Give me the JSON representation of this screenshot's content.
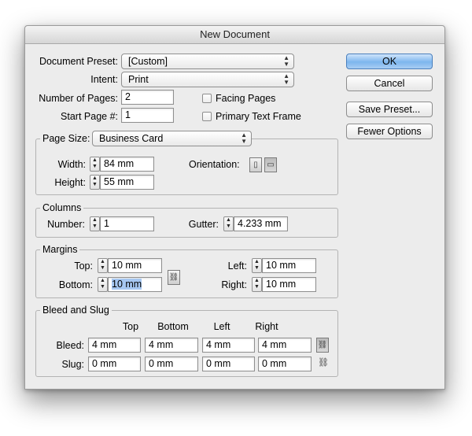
{
  "window": {
    "title": "New Document"
  },
  "document": {
    "preset_label": "Document Preset:",
    "preset_value": "[Custom]",
    "intent_label": "Intent:",
    "intent_value": "Print",
    "pages_label": "Number of Pages:",
    "pages_value": "2",
    "start_label": "Start Page #:",
    "start_value": "1",
    "facing_label": "Facing Pages",
    "primary_label": "Primary Text Frame"
  },
  "buttons": {
    "ok": "OK",
    "cancel": "Cancel",
    "save_preset": "Save Preset...",
    "fewer_options": "Fewer Options"
  },
  "page_size": {
    "label": "Page Size:",
    "value": "Business Card",
    "width_label": "Width:",
    "width_value": "84 mm",
    "height_label": "Height:",
    "height_value": "55 mm",
    "orientation_label": "Orientation:"
  },
  "columns": {
    "legend": "Columns",
    "number_label": "Number:",
    "number_value": "1",
    "gutter_label": "Gutter:",
    "gutter_value": "4.233 mm"
  },
  "margins": {
    "legend": "Margins",
    "top_label": "Top:",
    "top_value": "10 mm",
    "bottom_label": "Bottom:",
    "bottom_value": "10 mm",
    "left_label": "Left:",
    "left_value": "10 mm",
    "right_label": "Right:",
    "right_value": "10 mm"
  },
  "bleed_slug": {
    "legend": "Bleed and Slug",
    "headers": [
      "Top",
      "Bottom",
      "Left",
      "Right"
    ],
    "bleed_label": "Bleed:",
    "bleed_values": [
      "4 mm",
      "4 mm",
      "4 mm",
      "4 mm"
    ],
    "slug_label": "Slug:",
    "slug_values": [
      "0 mm",
      "0 mm",
      "0 mm",
      "0 mm"
    ]
  },
  "icons": {
    "select_arrows": "⬍",
    "spin_up": "▲",
    "spin_down": "▼",
    "link": "⛓",
    "portrait": "▯",
    "landscape": "▭"
  }
}
